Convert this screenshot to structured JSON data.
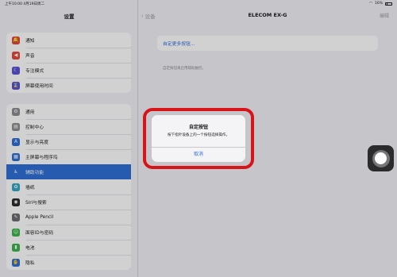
{
  "statusbar": {
    "time": "上午10:00   4月19日周二",
    "battery": "16%"
  },
  "sidebar": {
    "title": "设置",
    "group1": [
      {
        "label": "通知",
        "icon": "bell-icon",
        "color": "#e9463a",
        "glyph": "🔔"
      },
      {
        "label": "声音",
        "icon": "speaker-icon",
        "color": "#e9463a",
        "glyph": "◀"
      },
      {
        "label": "专注模式",
        "icon": "moon-icon",
        "color": "#5b53d6",
        "glyph": "☾"
      },
      {
        "label": "屏幕使用时间",
        "icon": "hourglass-icon",
        "color": "#5b53d6",
        "glyph": "⌛"
      }
    ],
    "group2": [
      {
        "label": "通用",
        "icon": "gear-icon",
        "color": "#8e8e93",
        "glyph": "⚙"
      },
      {
        "label": "控制中心",
        "icon": "switches-icon",
        "color": "#8e8e93",
        "glyph": "▤"
      },
      {
        "label": "显示与亮度",
        "icon": "display-brightness-icon",
        "color": "#2f6fd6",
        "glyph": "A"
      },
      {
        "label": "主屏幕与程序坞",
        "icon": "home-screen-icon",
        "color": "#2f6fd6",
        "glyph": "▦"
      },
      {
        "label": "辅助功能",
        "icon": "accessibility-icon",
        "color": "#2f6fd6",
        "glyph": "♿"
      },
      {
        "label": "墙纸",
        "icon": "wallpaper-icon",
        "color": "#33a6c6",
        "glyph": "✿"
      },
      {
        "label": "Siri与搜索",
        "icon": "siri-icon",
        "color": "#2b2b2d",
        "glyph": "◉"
      },
      {
        "label": "Apple Pencil",
        "icon": "pencil-icon",
        "color": "#6d6d72",
        "glyph": "✎"
      },
      {
        "label": "面容ID与密码",
        "icon": "face-id-icon",
        "color": "#3bb54a",
        "glyph": "☺"
      },
      {
        "label": "电池",
        "icon": "battery-icon",
        "color": "#3bb54a",
        "glyph": "▮"
      },
      {
        "label": "隐私",
        "icon": "hand-icon",
        "color": "#2f6fd6",
        "glyph": "✋"
      }
    ],
    "selected_index": 4
  },
  "detail": {
    "back_label": "设备",
    "title": "ELECOM EX-G",
    "edit_label": "编辑",
    "custom_button_row": "自定更多按钮...",
    "footnote": "自定按钮来启用辅助触控。"
  },
  "alert": {
    "title": "自定按钮",
    "message": "按下指针设备上的一个按钮选择操作。",
    "cancel": "取消"
  },
  "colors": {
    "accent": "#2f6fd6",
    "highlight": "#d8141b"
  }
}
